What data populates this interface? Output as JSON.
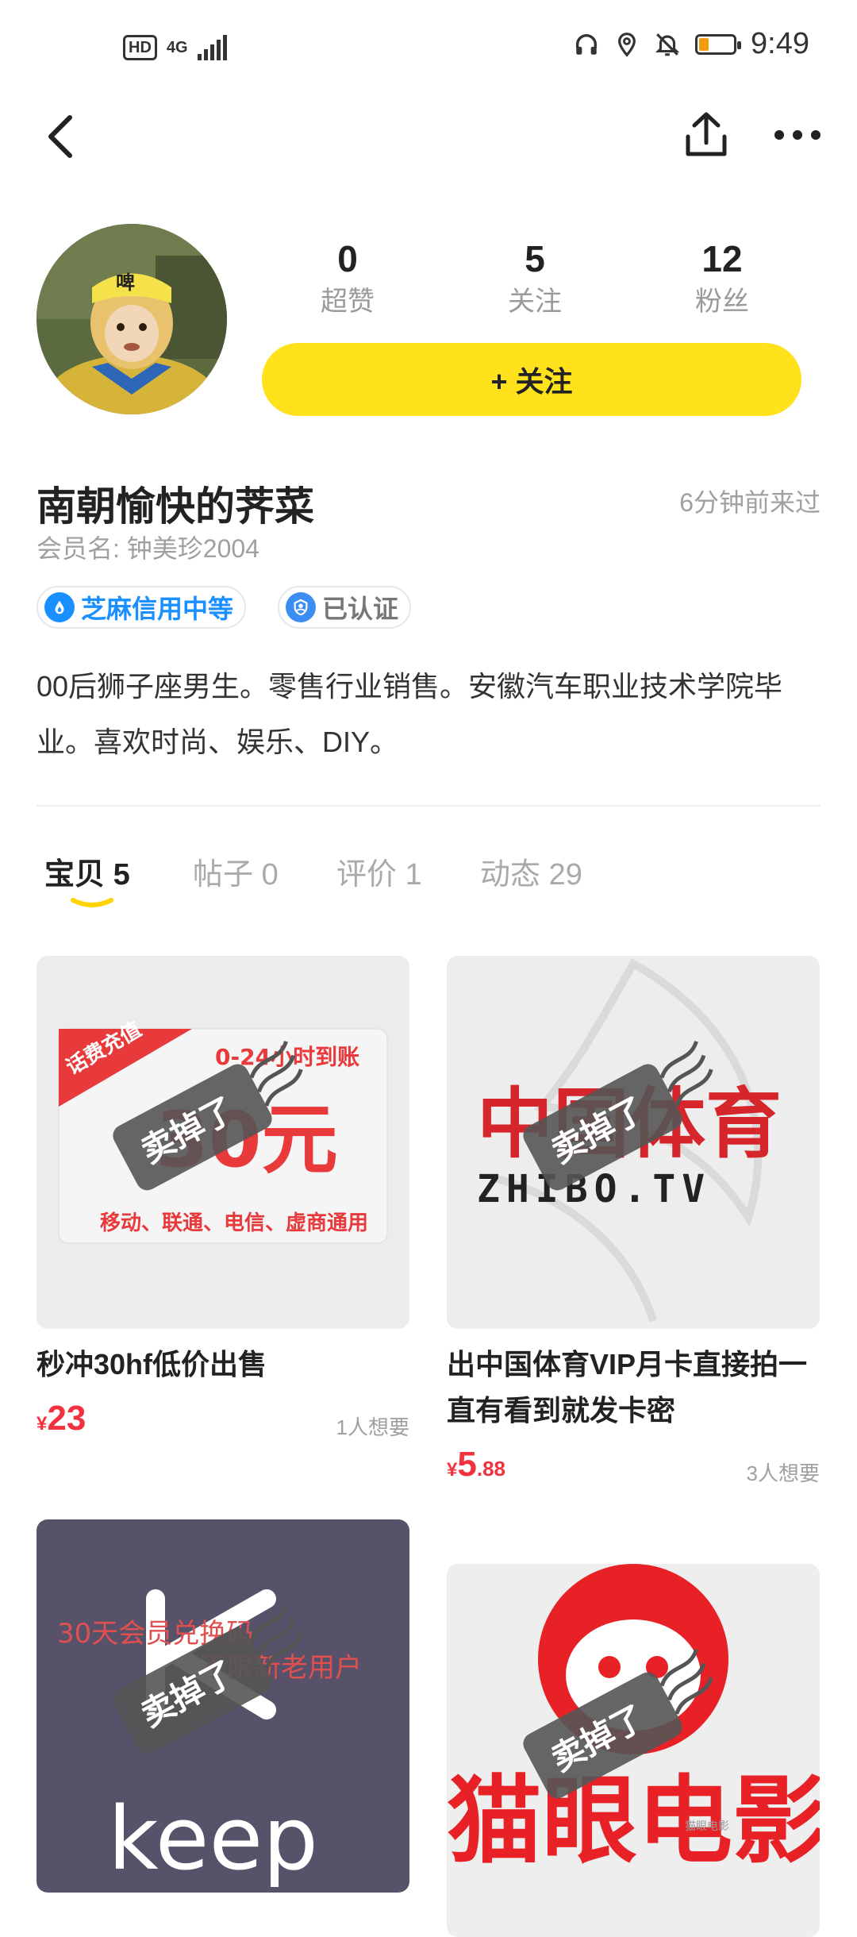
{
  "status_bar": {
    "hd": "HD",
    "network": "4G",
    "time": "9:49"
  },
  "profile": {
    "stats": [
      {
        "value": "0",
        "label": "超赞"
      },
      {
        "value": "5",
        "label": "关注"
      },
      {
        "value": "12",
        "label": "粉丝"
      }
    ],
    "follow_button": "+ 关注",
    "nickname": "南朝愉快的荠菜",
    "last_visit": "6分钟前来过",
    "member_name": "会员名: 钟美珍2004",
    "badges": [
      {
        "label": "芝麻信用中等",
        "icon": "sesame-credit-icon"
      },
      {
        "label": "已认证",
        "icon": "verified-icon"
      }
    ],
    "bio": "00后狮子座男生。零售行业销售。安徽汽车职业技术学院毕业。喜欢时尚、娱乐、DIY。"
  },
  "tabs": [
    {
      "label": "宝贝",
      "count": "5",
      "active": true
    },
    {
      "label": "帖子",
      "count": "0",
      "active": false
    },
    {
      "label": "评价",
      "count": "1",
      "active": false
    },
    {
      "label": "动态",
      "count": "29",
      "active": false
    }
  ],
  "items": [
    {
      "title": "秒冲30hf低价出售",
      "price_symbol": "¥",
      "price_int": "23",
      "price_dec": "",
      "wants": "1人想要",
      "sold_stamp": "卖掉了",
      "image_text": {
        "ribbon": "话费充值",
        "top": "0-24小时到账",
        "big": "30元",
        "bottom": "移动、联通、电信、虚商通用"
      }
    },
    {
      "title": "出中国体育VIP月卡直接拍一直有看到就发卡密",
      "price_symbol": "¥",
      "price_int": "5",
      "price_dec": ".88",
      "wants": "3人想要",
      "sold_stamp": "卖掉了",
      "image_text": {
        "cn": "中国体育",
        "en": "ZHIBO.TV"
      }
    },
    {
      "sold_stamp": "卖掉了",
      "image_text": {
        "line1": "30天会员兑换码",
        "line2": "不限新老用户",
        "brand": "keep"
      }
    },
    {
      "sold_stamp": "卖掉了",
      "image_text": {
        "brand": "猫眼电影",
        "corner": "猫眼电影"
      }
    }
  ]
}
